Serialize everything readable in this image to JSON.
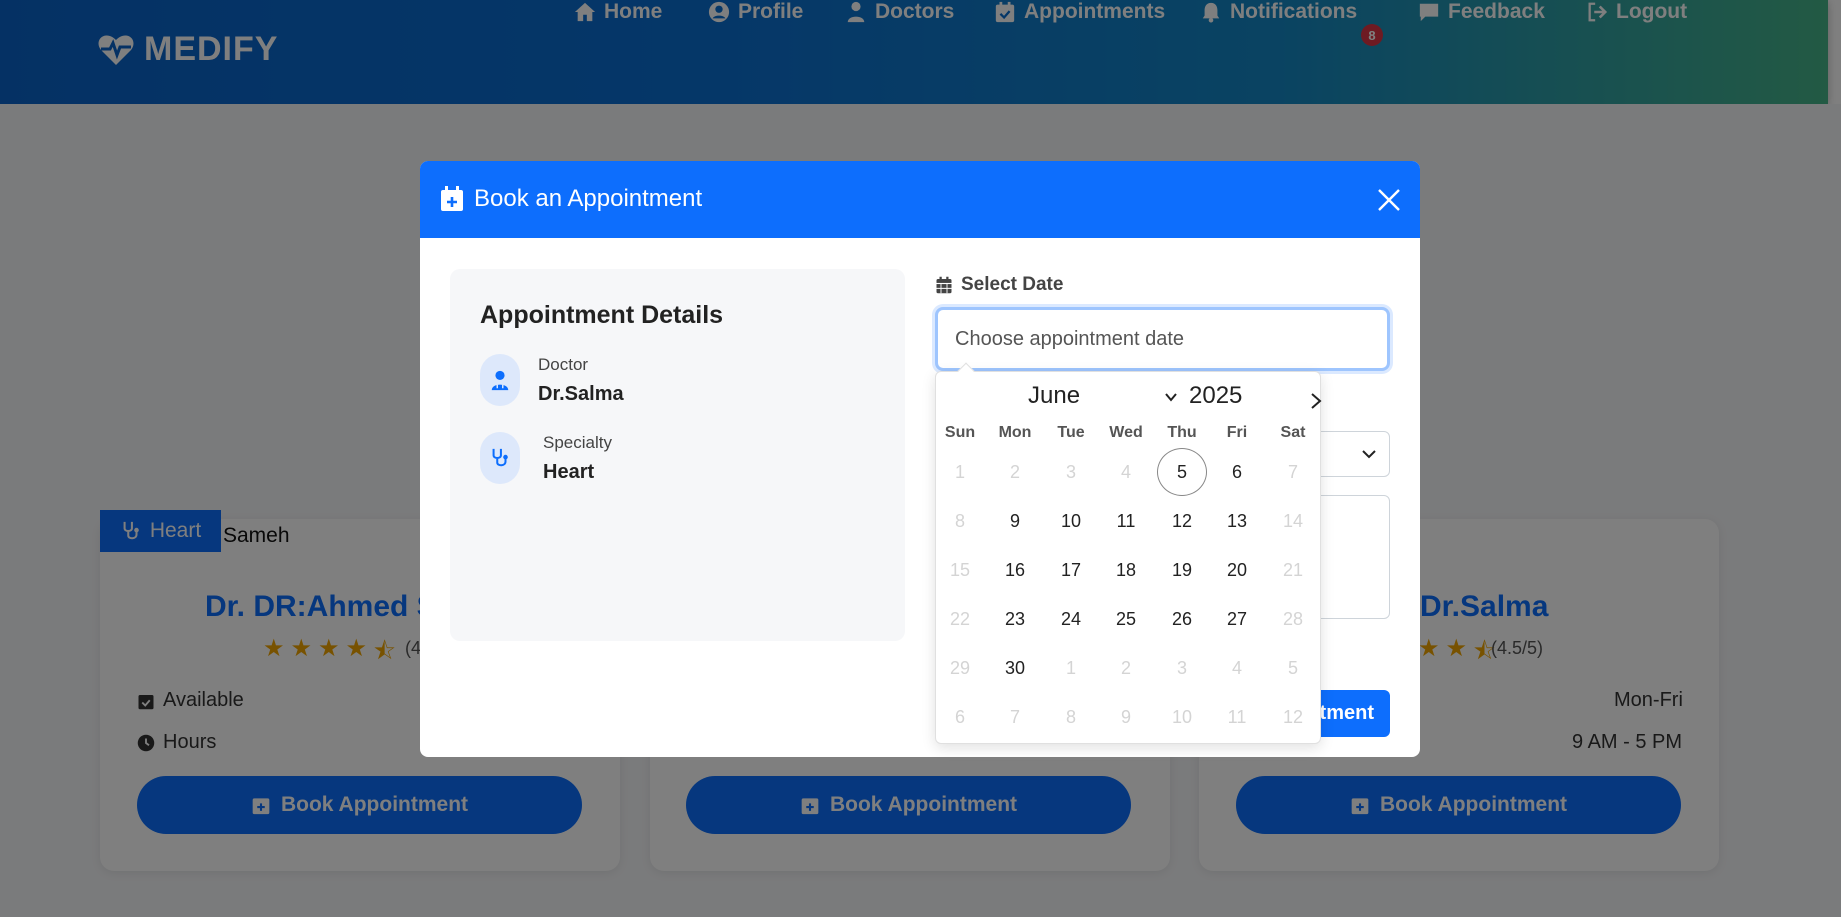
{
  "brand": {
    "name": "MEDIFY"
  },
  "nav": {
    "home": "Home",
    "profile": "Profile",
    "doctors": "Doctors",
    "appointments": "Appointments",
    "notifications": "Notifications",
    "notification_count": "8",
    "feedback": "Feedback",
    "logout": "Logout"
  },
  "cards": {
    "badge": "Heart",
    "badge_extra": "Sameh",
    "doctor1": "Dr. DR:Ahmed S",
    "doctor1_rating": "(4",
    "doctor3": "Dr.Salma",
    "doctor3_rating": "(4.5/5)",
    "available_label": "Available",
    "hours_label": "Hours",
    "days_value": "Mon-Fri",
    "hours_value": "9 AM - 5 PM",
    "book_label": "Book Appointment"
  },
  "modal": {
    "title": "Book an Appointment",
    "details_title": "Appointment Details",
    "doctor_label": "Doctor",
    "doctor_value": "Dr.Salma",
    "specialty_label": "Specialty",
    "specialty_value": "Heart",
    "select_date_label": "Select Date",
    "date_placeholder": "Choose appointment date",
    "confirm_label": "ntment"
  },
  "calendar": {
    "month": "June",
    "year": "2025",
    "weekdays": [
      "Sun",
      "Mon",
      "Tue",
      "Wed",
      "Thu",
      "Fri",
      "Sat"
    ],
    "today": 5,
    "weeks": [
      [
        [
          "1",
          1
        ],
        [
          "2",
          1
        ],
        [
          "3",
          1
        ],
        [
          "4",
          1
        ],
        [
          "5",
          0
        ],
        [
          "6",
          0
        ],
        [
          "7",
          1
        ]
      ],
      [
        [
          "8",
          1
        ],
        [
          "9",
          0
        ],
        [
          "10",
          0
        ],
        [
          "11",
          0
        ],
        [
          "12",
          0
        ],
        [
          "13",
          0
        ],
        [
          "14",
          1
        ]
      ],
      [
        [
          "15",
          1
        ],
        [
          "16",
          0
        ],
        [
          "17",
          0
        ],
        [
          "18",
          0
        ],
        [
          "19",
          0
        ],
        [
          "20",
          0
        ],
        [
          "21",
          1
        ]
      ],
      [
        [
          "22",
          1
        ],
        [
          "23",
          0
        ],
        [
          "24",
          0
        ],
        [
          "25",
          0
        ],
        [
          "26",
          0
        ],
        [
          "27",
          0
        ],
        [
          "28",
          1
        ]
      ],
      [
        [
          "29",
          1
        ],
        [
          "30",
          0
        ],
        [
          "1",
          1
        ],
        [
          "2",
          1
        ],
        [
          "3",
          1
        ],
        [
          "4",
          1
        ],
        [
          "5",
          1
        ]
      ],
      [
        [
          "6",
          1
        ],
        [
          "7",
          1
        ],
        [
          "8",
          1
        ],
        [
          "9",
          1
        ],
        [
          "10",
          1
        ],
        [
          "11",
          1
        ],
        [
          "12",
          1
        ]
      ]
    ]
  },
  "colors": {
    "primary": "#0d6efd",
    "star": "#f0a500",
    "badge": "#dc3545"
  }
}
